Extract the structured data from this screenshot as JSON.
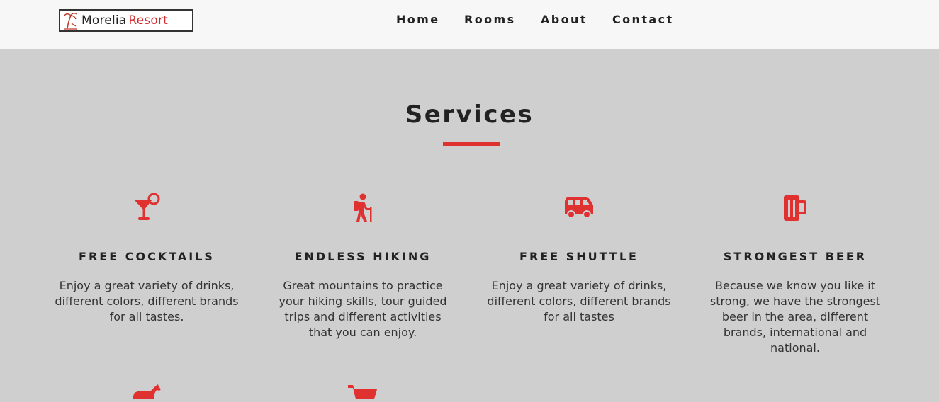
{
  "navbar": {
    "logo": {
      "text_primary": "Morelia",
      "text_accent": "Resort"
    },
    "links": [
      "Home",
      "Rooms",
      "About",
      "Contact"
    ]
  },
  "services": {
    "title": "Services",
    "items": [
      {
        "icon": "cocktail-icon",
        "title": "FREE COCKTAILS",
        "text": "Enjoy a great variety of drinks, different colors, different brands for all tastes."
      },
      {
        "icon": "hiking-icon",
        "title": "ENDLESS HIKING",
        "text": "Great mountains to practice your hiking skills, tour guided trips and different activities that you can enjoy."
      },
      {
        "icon": "shuttle-icon",
        "title": "FREE SHUTTLE",
        "text": "Enjoy a great variety of drinks, different colors, different brands for all tastes"
      },
      {
        "icon": "beer-icon",
        "title": "STRONGEST BEER",
        "text": "Because we know you like it strong, we have the strongest beer in the area, different brands, international and national."
      }
    ],
    "partial_icons": [
      "horse-icon",
      "shopping-cart-icon"
    ]
  },
  "colors": {
    "accent": "#e03131",
    "background": "#cfcfcf",
    "navbar": "#f7f7f7",
    "text": "#222222"
  }
}
